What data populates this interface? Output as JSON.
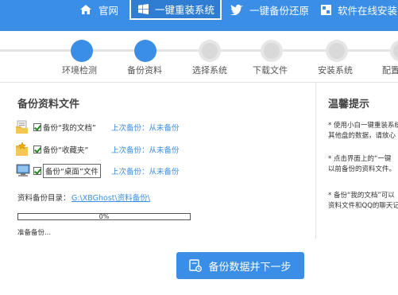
{
  "nav": {
    "items": [
      {
        "label": "官网",
        "icon": "home-icon"
      },
      {
        "label": "一键重装系统",
        "icon": "windows-icon",
        "active": true
      },
      {
        "label": "一键备份还原",
        "icon": "bird-icon"
      },
      {
        "label": "软件在线安装",
        "icon": "apps-icon"
      }
    ]
  },
  "steps": {
    "labels": [
      "环境检测",
      "备份资料",
      "选择系统",
      "下载文件",
      "安装系统",
      "配置"
    ],
    "completed": 2
  },
  "backup": {
    "title": "备份资料文件",
    "rows": [
      {
        "name": "备份“我的文档”",
        "last": "上次备份：从未备份",
        "icon": "folder-documents-icon",
        "checked": true
      },
      {
        "name": "备份“收藏夹”",
        "last": "上次备份：从未备份",
        "icon": "folder-favorites-icon",
        "checked": true
      },
      {
        "name": "备份“桌面”文件",
        "last": "上次备份：从未备份",
        "icon": "desktop-icon",
        "checked": true
      }
    ],
    "dir_label": "资料备份目录：",
    "dir_path": "G:\\XBGhost\\资料备份\\",
    "progress_text": "0%",
    "progress_value": 0,
    "status": "准备备份..."
  },
  "tips": {
    "title": "温馨提示",
    "items": [
      [
        "* 使用小白一键重装系统",
        "其他盘的数据，请放心"
      ],
      [
        "* 点击界面上的“一键",
        "以前备份的资料文件。"
      ],
      [
        "* 备份“我的文档”可以",
        "资料文件和QQ的聊天记"
      ]
    ]
  },
  "main_button": {
    "label": "备份数据并下一步",
    "icon": "backup-icon"
  },
  "colors": {
    "accent": "#3a8ee6",
    "step_inactive": "#e6e6e6"
  }
}
